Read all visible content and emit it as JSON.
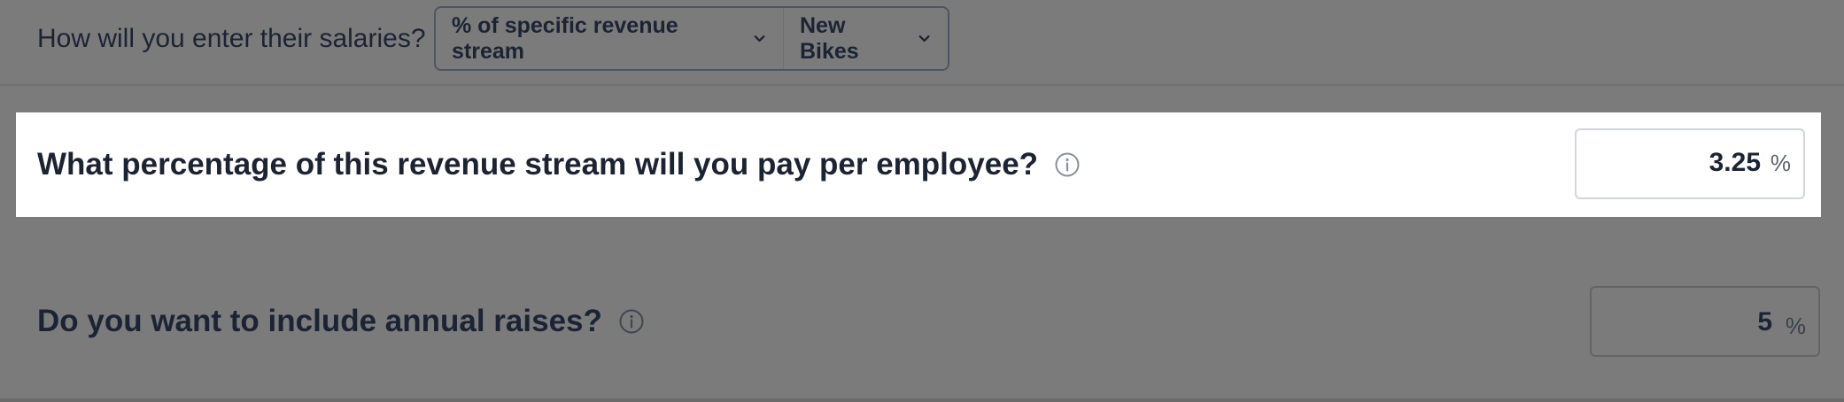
{
  "salary_entry": {
    "question": "How will you enter their salaries?",
    "method_select": {
      "value": "% of specific revenue stream"
    },
    "stream_select": {
      "value": "New Bikes"
    }
  },
  "percentage_row": {
    "question": "What percentage of this revenue stream will you pay per employee?",
    "value": "3.25",
    "unit": "%"
  },
  "raises_row": {
    "question": "Do you want to include annual raises?",
    "value": "5",
    "unit": "%"
  },
  "icons": {
    "info": "info-icon",
    "chevron": "chevron-down-icon"
  },
  "colors": {
    "overlay": "#7b7b7b",
    "text": "#1c2333",
    "highlight": "#ffffff"
  }
}
